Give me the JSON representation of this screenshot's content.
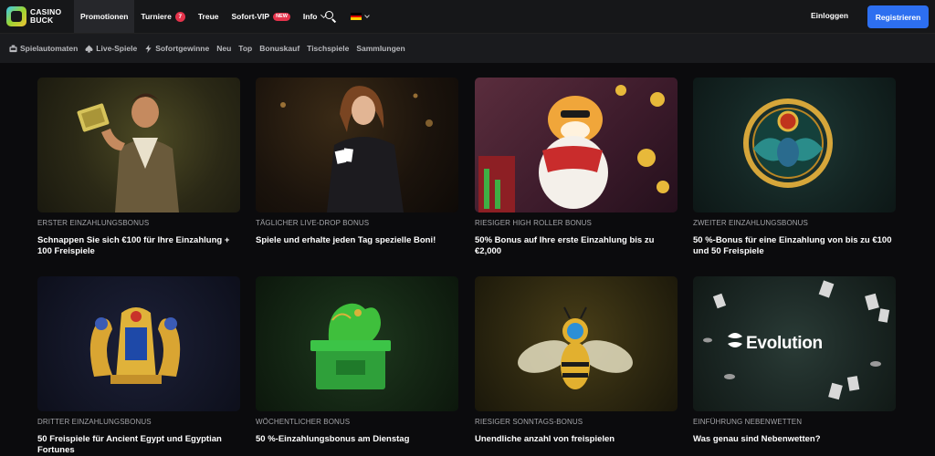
{
  "brand": {
    "logo_line1": "CASINO",
    "logo_line2": "BUCK"
  },
  "nav": {
    "items": [
      {
        "label": "Promotionen",
        "active": true
      },
      {
        "label": "Turniere",
        "count": "7"
      },
      {
        "label": "Treue"
      },
      {
        "label": "Sofort-VIP",
        "badge": "NEW"
      },
      {
        "label": "Info"
      }
    ],
    "language_icon": "german-flag-icon",
    "search_icon": "search-icon"
  },
  "auth": {
    "login_label": "Einloggen",
    "register_label": "Registrieren"
  },
  "categories": [
    {
      "label": "Spielautomaten",
      "icon": "slot-machine-icon"
    },
    {
      "label": "Live-Spiele",
      "icon": "spade-icon"
    },
    {
      "label": "Sofortgewinne",
      "icon": "lightning-icon"
    },
    {
      "label": "Neu"
    },
    {
      "label": "Top"
    },
    {
      "label": "Bonuskauf"
    },
    {
      "label": "Tischspiele"
    },
    {
      "label": "Sammlungen"
    }
  ],
  "promotions": [
    {
      "category": "ERSTER EINZAHLUNGSBONUS",
      "title": "Schnappen Sie sich €100 für Ihre Einzahlung + 100 Freispiele",
      "image": "adventurer-with-book-image"
    },
    {
      "category": "TÄGLICHER LIVE-DROP BONUS",
      "title": "Spiele und erhalte jeden Tag spezielle Boni!",
      "image": "live-dealer-with-cards-image"
    },
    {
      "category": "RIESIGER HIGH ROLLER BONUS",
      "title": "50% Bonus auf Ihre erste Einzahlung bis zu €2,000",
      "image": "tiger-with-coins-image"
    },
    {
      "category": "ZWEITER EINZAHLUNGSBONUS",
      "title": "50 %-Bonus für eine Einzahlung von bis zu €100 und 50 Freispiele",
      "image": "golden-scarab-image"
    },
    {
      "category": "DRITTER EINZAHLUNGSBONUS",
      "title": "50 Freispiele für Ancient Egypt und Egyptian Fortunes",
      "image": "egyptian-cobra-crown-image"
    },
    {
      "category": "WÖCHENTLICHER BONUS",
      "title": "50 %-Einzahlungsbonus am Dienstag",
      "image": "jade-dragon-chest-image"
    },
    {
      "category": "RIESIGER SONNTAGS-BONUS",
      "title": "Unendliche anzahl von freispielen",
      "image": "golden-bee-image"
    },
    {
      "category": "EINFÜHRUNG NEBENWETTEN",
      "title": "Was genau sind Nebenwetten?",
      "image": "evolution-cards-chips-image",
      "logo_text": "Evolution"
    }
  ],
  "colors": {
    "accent": "#2d6ff0",
    "badge": "#e5334b",
    "background": "#0b0b0d",
    "topbar": "#161719"
  }
}
